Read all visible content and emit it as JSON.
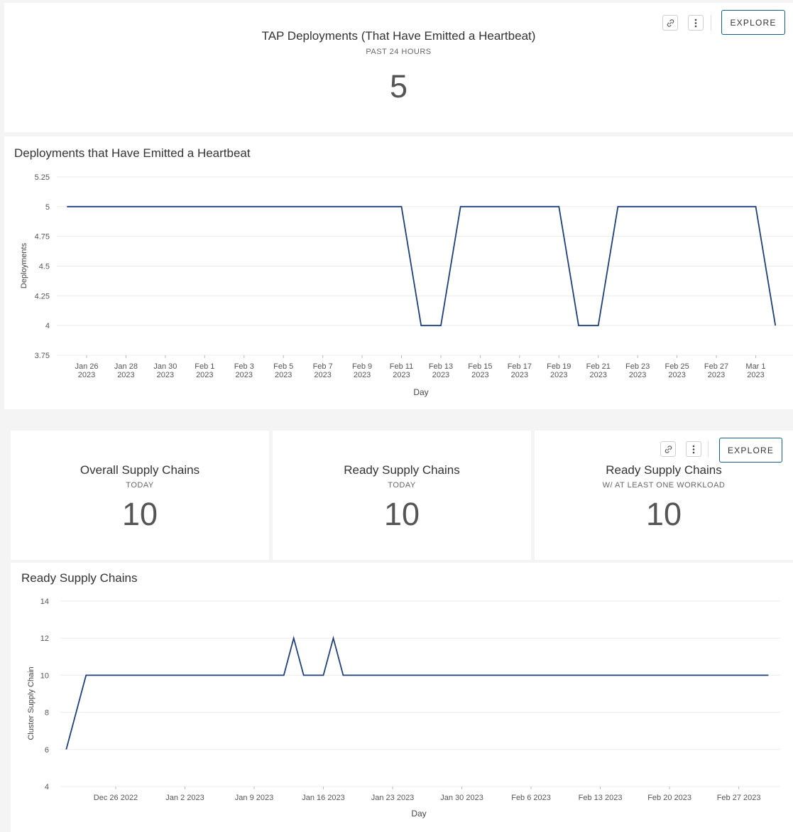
{
  "top_panel": {
    "title": "TAP Deployments (That Have Emitted a Heartbeat)",
    "subtitle": "PAST 24 HOURS",
    "value": "5",
    "explore_label": "EXPLORE"
  },
  "stats": [
    {
      "title": "Overall Supply Chains",
      "subtitle": "TODAY",
      "value": "10"
    },
    {
      "title": "Ready Supply Chains",
      "subtitle": "TODAY",
      "value": "10"
    },
    {
      "title": "Ready Supply Chains",
      "subtitle": "W/ AT LEAST ONE WORKLOAD",
      "value": "10",
      "explore_label": "EXPLORE"
    }
  ],
  "icons": {
    "link": "link-icon",
    "menu": "more-vertical-icon"
  },
  "colors": {
    "line": "#1f3f7a",
    "accent": "#0f5f8f"
  },
  "chart_data": [
    {
      "type": "line",
      "title": "Deployments that Have Emitted a Heartbeat",
      "xlabel": "Day",
      "ylabel": "Deployments",
      "ylim": [
        3.75,
        5.25
      ],
      "yticks": [
        "5.25",
        "5",
        "4.75",
        "4.5",
        "4.25",
        "4",
        "3.75"
      ],
      "xticks": [
        {
          "date": "2023-01-26",
          "label": [
            "Jan 26",
            "2023"
          ]
        },
        {
          "date": "2023-01-28",
          "label": [
            "Jan 28",
            "2023"
          ]
        },
        {
          "date": "2023-01-30",
          "label": [
            "Jan 30",
            "2023"
          ]
        },
        {
          "date": "2023-02-01",
          "label": [
            "Feb 1",
            "2023"
          ]
        },
        {
          "date": "2023-02-03",
          "label": [
            "Feb 3",
            "2023"
          ]
        },
        {
          "date": "2023-02-05",
          "label": [
            "Feb 5",
            "2023"
          ]
        },
        {
          "date": "2023-02-07",
          "label": [
            "Feb 7",
            "2023"
          ]
        },
        {
          "date": "2023-02-09",
          "label": [
            "Feb 9",
            "2023"
          ]
        },
        {
          "date": "2023-02-11",
          "label": [
            "Feb 11",
            "2023"
          ]
        },
        {
          "date": "2023-02-13",
          "label": [
            "Feb 13",
            "2023"
          ]
        },
        {
          "date": "2023-02-15",
          "label": [
            "Feb 15",
            "2023"
          ]
        },
        {
          "date": "2023-02-17",
          "label": [
            "Feb 17",
            "2023"
          ]
        },
        {
          "date": "2023-02-19",
          "label": [
            "Feb 19",
            "2023"
          ]
        },
        {
          "date": "2023-02-21",
          "label": [
            "Feb 21",
            "2023"
          ]
        },
        {
          "date": "2023-02-23",
          "label": [
            "Feb 23",
            "2023"
          ]
        },
        {
          "date": "2023-02-25",
          "label": [
            "Feb 25",
            "2023"
          ]
        },
        {
          "date": "2023-02-27",
          "label": [
            "Feb 27",
            "2023"
          ]
        },
        {
          "date": "2023-03-01",
          "label": [
            "Mar 1",
            "2023"
          ]
        }
      ],
      "series": [
        {
          "points": [
            [
              "2023-01-25",
              5
            ],
            [
              "2023-02-11",
              5
            ],
            [
              "2023-02-12",
              4
            ],
            [
              "2023-02-13",
              4
            ],
            [
              "2023-02-14",
              5
            ],
            [
              "2023-02-19",
              5
            ],
            [
              "2023-02-20",
              4
            ],
            [
              "2023-02-21",
              4
            ],
            [
              "2023-02-22",
              5
            ],
            [
              "2023-03-01",
              5
            ],
            [
              "2023-03-02",
              4
            ]
          ]
        }
      ],
      "grid": true
    },
    {
      "type": "line",
      "title": "Ready Supply Chains",
      "xlabel": "Day",
      "ylabel": "Cluster Supply Chain",
      "ylim": [
        4,
        14
      ],
      "yticks": [
        "14",
        "12",
        "10",
        "8",
        "6",
        "4"
      ],
      "xticks": [
        {
          "date": "2022-12-26",
          "label": [
            "Dec 26 2022"
          ]
        },
        {
          "date": "2023-01-02",
          "label": [
            "Jan 2 2023"
          ]
        },
        {
          "date": "2023-01-09",
          "label": [
            "Jan 9 2023"
          ]
        },
        {
          "date": "2023-01-16",
          "label": [
            "Jan 16 2023"
          ]
        },
        {
          "date": "2023-01-23",
          "label": [
            "Jan 23 2023"
          ]
        },
        {
          "date": "2023-01-30",
          "label": [
            "Jan 30 2023"
          ]
        },
        {
          "date": "2023-02-06",
          "label": [
            "Feb 6 2023"
          ]
        },
        {
          "date": "2023-02-13",
          "label": [
            "Feb 13 2023"
          ]
        },
        {
          "date": "2023-02-20",
          "label": [
            "Feb 20 2023"
          ]
        },
        {
          "date": "2023-02-27",
          "label": [
            "Feb 27 2023"
          ]
        }
      ],
      "series": [
        {
          "points": [
            [
              "2022-12-21",
              6
            ],
            [
              "2022-12-23",
              10
            ],
            [
              "2023-01-12",
              10
            ],
            [
              "2023-01-13",
              12
            ],
            [
              "2023-01-14",
              10
            ],
            [
              "2023-01-16",
              10
            ],
            [
              "2023-01-17",
              12
            ],
            [
              "2023-01-18",
              10
            ],
            [
              "2023-03-02",
              10
            ]
          ]
        }
      ],
      "grid": true
    }
  ]
}
